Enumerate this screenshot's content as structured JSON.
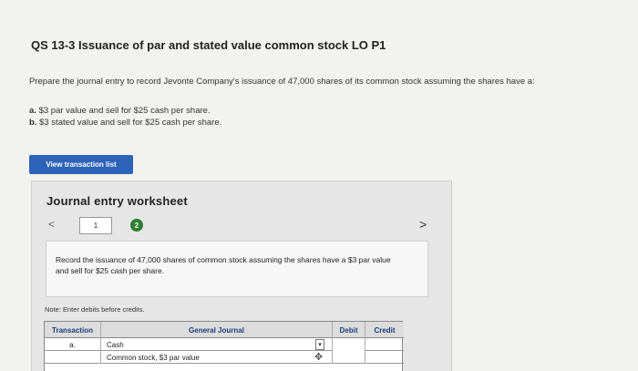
{
  "question": {
    "title": "QS 13-3 Issuance of par and stated value common stock LO P1",
    "prompt": "Prepare the journal entry to record Jevonte Company's issuance of 47,000 shares of its common stock assuming the shares have a:",
    "part_a_label": "a.",
    "part_a_text": "$3 par value and sell for $25 cash per share.",
    "part_b_label": "b.",
    "part_b_text": "$3 stated value and sell for $25 cash per share."
  },
  "toolbar": {
    "view_transaction_list": "View transaction list"
  },
  "worksheet": {
    "title": "Journal entry worksheet",
    "prev_icon": "<",
    "next_icon": ">",
    "page_1": "1",
    "page_2": "2",
    "instruction": "Record the issuance of 47,000 shares of common stock assuming the shares have a $3 par value and sell for $25 cash per share.",
    "note": "Note: Enter debits before credits."
  },
  "journal": {
    "headers": {
      "transaction": "Transaction",
      "general_journal": "General Journal",
      "debit": "Debit",
      "credit": "Credit"
    },
    "rows": [
      {
        "transaction": "a.",
        "account": "Cash"
      },
      {
        "transaction": "",
        "account": "Common stock, $3 par value"
      }
    ]
  },
  "colors": {
    "accent": "#2d63b8",
    "active_page": "#2e7d32",
    "header_text": "#1a3d7a"
  }
}
